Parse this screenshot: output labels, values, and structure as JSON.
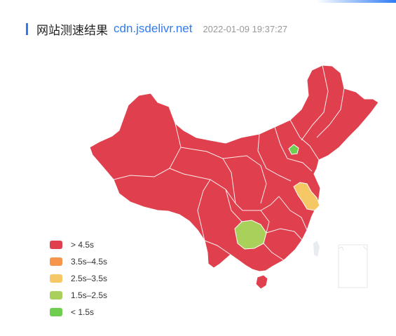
{
  "header": {
    "title": "网站测速结果",
    "domain": "cdn.jsdelivr.net",
    "timestamp": "2022-01-09 19:37:27"
  },
  "colors": {
    "accent": "#2f7bf4",
    "very_slow": "#e0404d",
    "slow": "#f5964c",
    "medium": "#f6c865",
    "fast": "#a8d05a",
    "very_fast": "#6fcd4f"
  },
  "legend": [
    {
      "label": "> 4.5s",
      "color": "#e0404d"
    },
    {
      "label": "3.5s–4.5s",
      "color": "#f5964c"
    },
    {
      "label": "2.5s–3.5s",
      "color": "#f6c865"
    },
    {
      "label": "1.5s–2.5s",
      "color": "#a8d05a"
    },
    {
      "label": "< 1.5s",
      "color": "#6fcd4f"
    }
  ],
  "map_regions": [
    {
      "id": "main",
      "speed_class": "> 4.5s"
    },
    {
      "id": "jiangsu",
      "speed_class": "2.5s–3.5s"
    },
    {
      "id": "guizhou",
      "speed_class": "1.5s–2.5s"
    },
    {
      "id": "beijing",
      "speed_class": "< 1.5s"
    }
  ]
}
